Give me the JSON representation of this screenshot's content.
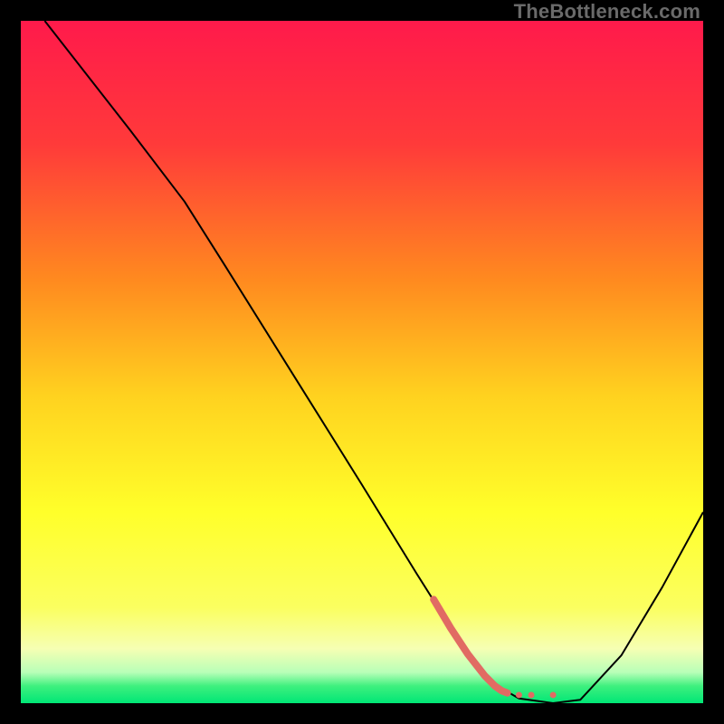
{
  "watermark": "TheBottleneck.com",
  "chart_data": {
    "type": "line",
    "title": "",
    "xlabel": "",
    "ylabel": "",
    "xlim": [
      0,
      100
    ],
    "ylim": [
      0,
      100
    ],
    "grid": false,
    "legend": false,
    "background": {
      "stops": [
        {
          "pos": 0.0,
          "color": "#ff1a4b"
        },
        {
          "pos": 0.18,
          "color": "#ff3a3a"
        },
        {
          "pos": 0.38,
          "color": "#ff8a1f"
        },
        {
          "pos": 0.55,
          "color": "#ffd21f"
        },
        {
          "pos": 0.72,
          "color": "#ffff2a"
        },
        {
          "pos": 0.86,
          "color": "#fbff60"
        },
        {
          "pos": 0.92,
          "color": "#f6ffb3"
        },
        {
          "pos": 0.955,
          "color": "#b8ffb8"
        },
        {
          "pos": 0.975,
          "color": "#3ef07e"
        },
        {
          "pos": 1.0,
          "color": "#00e676"
        }
      ]
    },
    "series": [
      {
        "name": "bottleneck-curve",
        "stroke": "#000000",
        "stroke_width": 2,
        "points": [
          {
            "x": 3.5,
            "y": 100.0
          },
          {
            "x": 16.0,
            "y": 84.0
          },
          {
            "x": 24.0,
            "y": 73.5
          },
          {
            "x": 30.0,
            "y": 64.0
          },
          {
            "x": 40.0,
            "y": 48.0
          },
          {
            "x": 50.0,
            "y": 32.0
          },
          {
            "x": 58.0,
            "y": 19.0
          },
          {
            "x": 64.0,
            "y": 9.5
          },
          {
            "x": 69.0,
            "y": 3.0
          },
          {
            "x": 73.0,
            "y": 0.7
          },
          {
            "x": 78.0,
            "y": 0.0
          },
          {
            "x": 82.0,
            "y": 0.5
          },
          {
            "x": 88.0,
            "y": 7.0
          },
          {
            "x": 94.0,
            "y": 17.0
          },
          {
            "x": 100.0,
            "y": 28.0
          }
        ]
      },
      {
        "name": "highlight-segment",
        "stroke": "#e16b63",
        "stroke_width": 8,
        "linecap": "round",
        "points": [
          {
            "x": 60.5,
            "y": 15.2
          },
          {
            "x": 63.0,
            "y": 11.0
          },
          {
            "x": 65.5,
            "y": 7.2
          },
          {
            "x": 68.0,
            "y": 4.0
          },
          {
            "x": 69.5,
            "y": 2.5
          },
          {
            "x": 70.5,
            "y": 1.8
          },
          {
            "x": 71.3,
            "y": 1.5
          }
        ]
      }
    ],
    "markers": [
      {
        "x": 73.0,
        "y": 1.2,
        "r": 3.5,
        "color": "#e16b63"
      },
      {
        "x": 74.8,
        "y": 1.2,
        "r": 3.5,
        "color": "#e16b63"
      },
      {
        "x": 78.0,
        "y": 1.2,
        "r": 3.5,
        "color": "#e16b63"
      }
    ]
  }
}
